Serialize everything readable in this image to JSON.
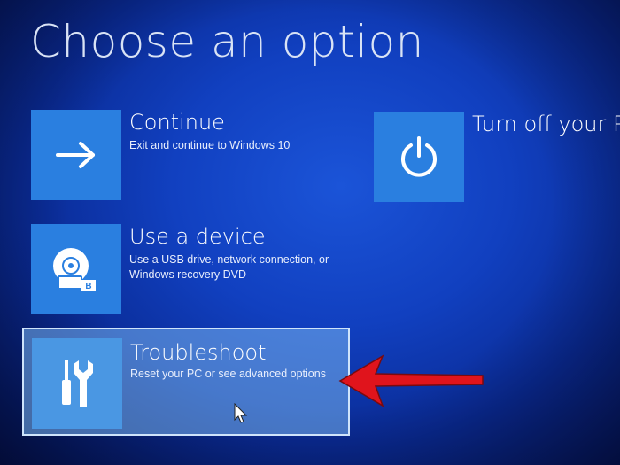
{
  "page": {
    "title": "Choose an option"
  },
  "options": [
    {
      "id": "continue",
      "title": "Continue",
      "description": "Exit and continue to Windows 10",
      "icon": "arrow-right-icon"
    },
    {
      "id": "turn-off",
      "title": "Turn off your PC",
      "icon": "power-icon"
    },
    {
      "id": "use-device",
      "title": "Use a device",
      "description": "Use a USB drive, network connection, or Windows recovery DVD",
      "icon": "disc-drive-icon"
    },
    {
      "id": "troubleshoot",
      "title": "Troubleshoot",
      "description": "Reset your PC or see advanced options",
      "icon": "tools-icon",
      "selected": true
    }
  ],
  "colors": {
    "background": "#1140c0",
    "tile": "#2a7fe0",
    "selected_highlight": "#78b4f0",
    "annotation_arrow": "#e0141c"
  }
}
